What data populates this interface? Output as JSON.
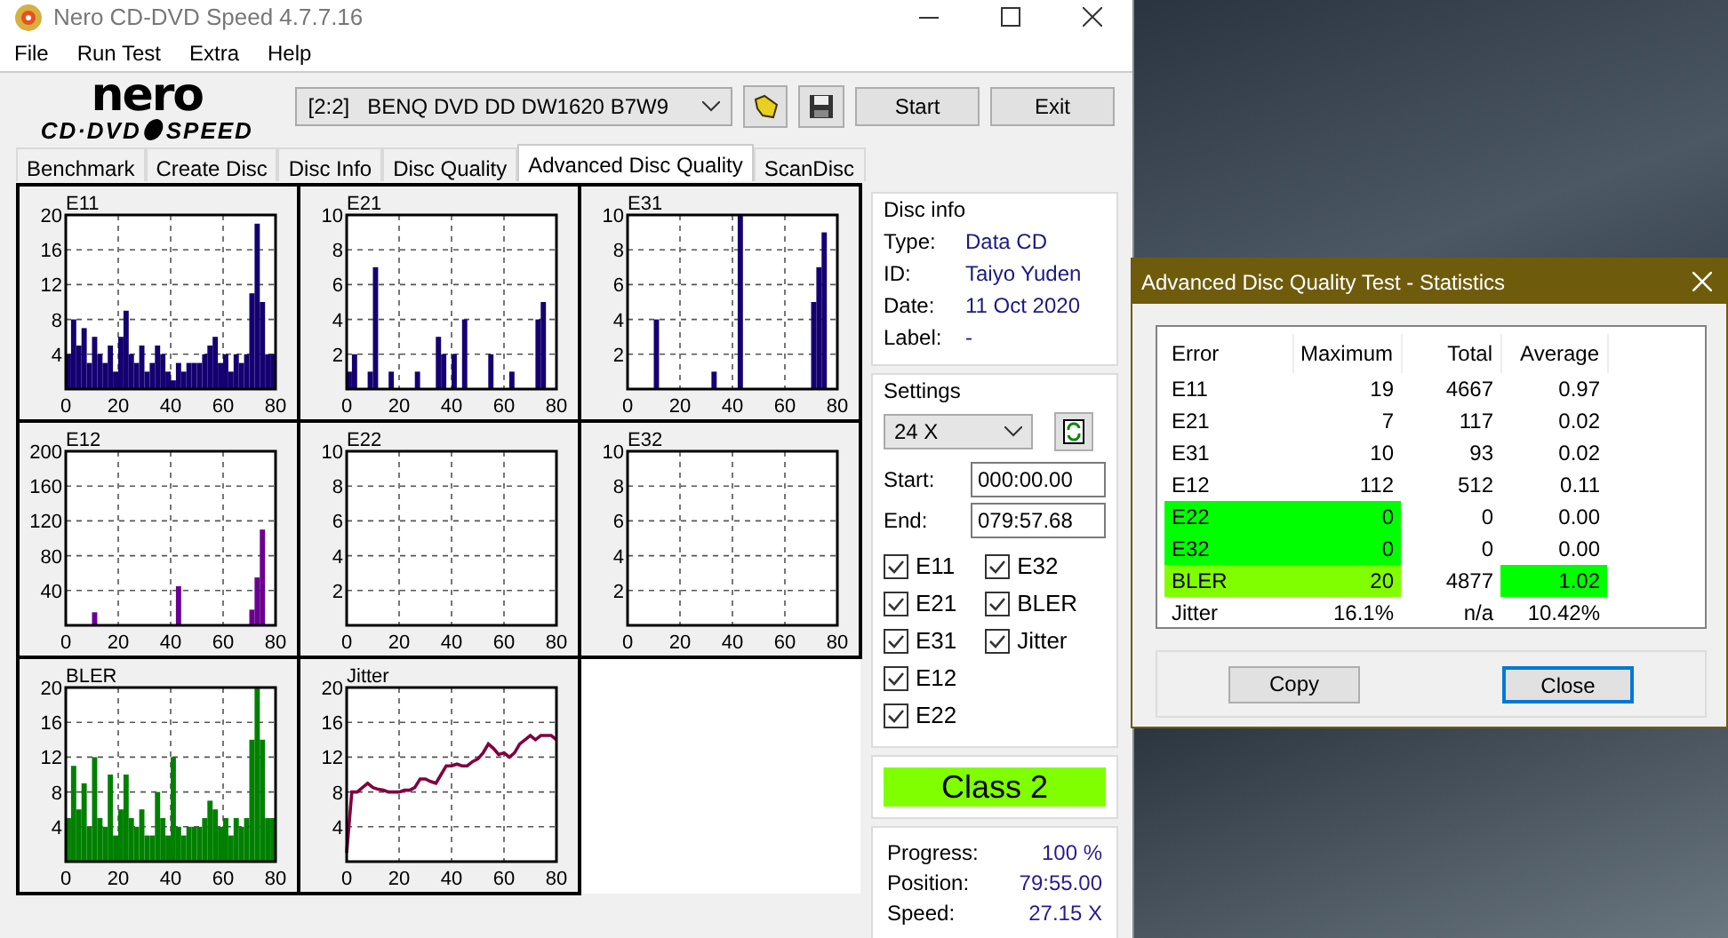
{
  "window": {
    "title": "Nero CD-DVD Speed 4.7.7.16"
  },
  "menu": [
    "File",
    "Run Test",
    "Extra",
    "Help"
  ],
  "logo": {
    "top": "nero",
    "left": "CD·DVD",
    "right": "SPEED"
  },
  "toolbar": {
    "drive": "[2:2]   BENQ DVD DD DW1620 B7W9",
    "buttons": [
      "Start",
      "Exit"
    ]
  },
  "tabs": [
    {
      "label": "Benchmark",
      "selected": false
    },
    {
      "label": "Create Disc",
      "selected": false
    },
    {
      "label": "Disc Info",
      "selected": false
    },
    {
      "label": "Disc Quality",
      "selected": false
    },
    {
      "label": "Advanced Disc Quality",
      "selected": true
    },
    {
      "label": "ScanDisc",
      "selected": false
    }
  ],
  "charts": [
    {
      "chart_data": {
        "type": "bar",
        "title": "E11",
        "grid": true,
        "x": [
          0,
          2,
          4,
          6,
          8,
          10,
          12,
          14,
          16,
          18,
          20,
          22,
          24,
          26,
          28,
          30,
          32,
          34,
          36,
          38,
          40,
          42,
          44,
          46,
          48,
          50,
          52,
          54,
          56,
          58,
          60,
          62,
          64,
          66,
          68,
          70,
          72,
          74,
          76,
          78
        ],
        "xlim": [
          0,
          80
        ],
        "ylim": [
          0,
          20
        ],
        "xticks": [
          0,
          20,
          40,
          60,
          80
        ],
        "yticks": [
          4,
          8,
          12,
          16,
          20
        ],
        "series": [
          {
            "color": "#140070",
            "values": [
              4,
              8,
              5,
              7,
              3,
              6,
              4,
              3,
              5,
              2,
              6,
              9,
              4,
              3,
              5,
              2,
              3,
              5,
              4,
              2,
              1,
              3,
              2,
              3,
              3,
              3,
              4,
              5,
              6,
              3,
              4,
              2,
              4,
              3,
              4,
              11,
              19,
              10,
              4,
              4
            ]
          }
        ]
      }
    },
    {
      "chart_data": {
        "type": "bar",
        "title": "E21",
        "grid": true,
        "x": [
          0,
          2,
          4,
          6,
          8,
          10,
          12,
          14,
          16,
          18,
          20,
          22,
          24,
          26,
          28,
          30,
          32,
          34,
          36,
          38,
          40,
          42,
          44,
          46,
          48,
          50,
          52,
          54,
          56,
          58,
          60,
          62,
          64,
          66,
          68,
          70,
          72,
          74,
          76,
          78
        ],
        "xlim": [
          0,
          80
        ],
        "ylim": [
          0,
          10
        ],
        "xticks": [
          0,
          20,
          40,
          60,
          80
        ],
        "yticks": [
          2,
          4,
          6,
          8,
          10
        ],
        "series": [
          {
            "color": "#140070",
            "values": [
              1,
              2,
              0,
              0,
              1,
              7,
              0,
              0,
              1,
              0,
              0,
              0,
              0,
              1,
              0,
              0,
              0,
              3,
              2,
              0,
              2,
              0,
              4,
              0,
              0,
              0,
              0,
              2,
              0,
              0,
              0,
              1,
              0,
              0,
              0,
              0,
              4,
              5,
              0,
              0
            ]
          }
        ]
      }
    },
    {
      "chart_data": {
        "type": "bar",
        "title": "E31",
        "grid": true,
        "x": [
          0,
          2,
          4,
          6,
          8,
          10,
          12,
          14,
          16,
          18,
          20,
          22,
          24,
          26,
          28,
          30,
          32,
          34,
          36,
          38,
          40,
          42,
          44,
          46,
          48,
          50,
          52,
          54,
          56,
          58,
          60,
          62,
          64,
          66,
          68,
          70,
          72,
          74,
          76,
          78
        ],
        "xlim": [
          0,
          80
        ],
        "ylim": [
          0,
          10
        ],
        "xticks": [
          0,
          20,
          40,
          60,
          80
        ],
        "yticks": [
          2,
          4,
          6,
          8,
          10
        ],
        "series": [
          {
            "color": "#140070",
            "values": [
              0,
              0,
              0,
              0,
              0,
              4,
              0,
              0,
              0,
              0,
              0,
              0,
              0,
              0,
              0,
              0,
              1,
              0,
              0,
              0,
              0,
              10,
              0,
              0,
              0,
              0,
              0,
              0,
              0,
              0,
              0,
              0,
              0,
              0,
              0,
              5,
              7,
              9,
              0,
              0
            ]
          }
        ]
      }
    },
    {
      "chart_data": {
        "type": "bar",
        "title": "E12",
        "grid": true,
        "x": [
          0,
          2,
          4,
          6,
          8,
          10,
          12,
          14,
          16,
          18,
          20,
          22,
          24,
          26,
          28,
          30,
          32,
          34,
          36,
          38,
          40,
          42,
          44,
          46,
          48,
          50,
          52,
          54,
          56,
          58,
          60,
          62,
          64,
          66,
          68,
          70,
          72,
          74,
          76,
          78
        ],
        "xlim": [
          0,
          80
        ],
        "ylim": [
          0,
          200
        ],
        "xticks": [
          0,
          20,
          40,
          60,
          80
        ],
        "yticks": [
          40,
          80,
          120,
          160,
          200
        ],
        "series": [
          {
            "color": "#6a0090",
            "values": [
              0,
              0,
              0,
              0,
              0,
              15,
              0,
              0,
              0,
              0,
              0,
              0,
              0,
              0,
              0,
              0,
              0,
              0,
              0,
              0,
              0,
              45,
              0,
              0,
              0,
              0,
              0,
              0,
              0,
              0,
              0,
              0,
              0,
              0,
              0,
              18,
              55,
              110,
              0,
              0
            ]
          }
        ]
      }
    },
    {
      "chart_data": {
        "type": "bar",
        "title": "E22",
        "grid": true,
        "x": [
          0,
          2,
          4,
          6,
          8,
          10,
          12,
          14,
          16,
          18,
          20,
          22,
          24,
          26,
          28,
          30,
          32,
          34,
          36,
          38,
          40,
          42,
          44,
          46,
          48,
          50,
          52,
          54,
          56,
          58,
          60,
          62,
          64,
          66,
          68,
          70,
          72,
          74,
          76,
          78
        ],
        "xlim": [
          0,
          80
        ],
        "ylim": [
          0,
          10
        ],
        "xticks": [
          0,
          20,
          40,
          60,
          80
        ],
        "yticks": [
          2,
          4,
          6,
          8,
          10
        ],
        "series": [
          {
            "values": [
              0,
              0,
              0,
              0,
              0,
              0,
              0,
              0,
              0,
              0,
              0,
              0,
              0,
              0,
              0,
              0,
              0,
              0,
              0,
              0,
              0,
              0,
              0,
              0,
              0,
              0,
              0,
              0,
              0,
              0,
              0,
              0,
              0,
              0,
              0,
              0,
              0,
              0,
              0,
              0
            ]
          }
        ]
      }
    },
    {
      "chart_data": {
        "type": "bar",
        "title": "E32",
        "grid": true,
        "x": [
          0,
          2,
          4,
          6,
          8,
          10,
          12,
          14,
          16,
          18,
          20,
          22,
          24,
          26,
          28,
          30,
          32,
          34,
          36,
          38,
          40,
          42,
          44,
          46,
          48,
          50,
          52,
          54,
          56,
          58,
          60,
          62,
          64,
          66,
          68,
          70,
          72,
          74,
          76,
          78
        ],
        "xlim": [
          0,
          80
        ],
        "ylim": [
          0,
          10
        ],
        "xticks": [
          0,
          20,
          40,
          60,
          80
        ],
        "yticks": [
          2,
          4,
          6,
          8,
          10
        ],
        "series": [
          {
            "values": [
              0,
              0,
              0,
              0,
              0,
              0,
              0,
              0,
              0,
              0,
              0,
              0,
              0,
              0,
              0,
              0,
              0,
              0,
              0,
              0,
              0,
              0,
              0,
              0,
              0,
              0,
              0,
              0,
              0,
              0,
              0,
              0,
              0,
              0,
              0,
              0,
              0,
              0,
              0,
              0
            ]
          }
        ]
      }
    },
    {
      "chart_data": {
        "type": "bar",
        "title": "BLER",
        "grid": true,
        "x": [
          0,
          2,
          4,
          6,
          8,
          10,
          12,
          14,
          16,
          18,
          20,
          22,
          24,
          26,
          28,
          30,
          32,
          34,
          36,
          38,
          40,
          42,
          44,
          46,
          48,
          50,
          52,
          54,
          56,
          58,
          60,
          62,
          64,
          66,
          68,
          70,
          72,
          74,
          76,
          78
        ],
        "xlim": [
          0,
          80
        ],
        "ylim": [
          0,
          20
        ],
        "xticks": [
          0,
          20,
          40,
          60,
          80
        ],
        "yticks": [
          4,
          8,
          12,
          16,
          20
        ],
        "series": [
          {
            "color": "#008000",
            "values": [
              5,
              11,
              6,
              9,
              4,
              12,
              5,
              4,
              10,
              3,
              6,
              10,
              5,
              4,
              6,
              3,
              3,
              8,
              5,
              3,
              12,
              4,
              3,
              4,
              4,
              4,
              5,
              7,
              6,
              4,
              5,
              3,
              5,
              4,
              5,
              14,
              20,
              14,
              5,
              5
            ]
          }
        ]
      }
    },
    {
      "chart_data": {
        "type": "line",
        "title": "Jitter",
        "grid": true,
        "x": [
          0,
          2,
          4,
          6,
          8,
          10,
          12,
          14,
          16,
          18,
          20,
          22,
          24,
          26,
          28,
          30,
          32,
          34,
          36,
          38,
          40,
          42,
          44,
          46,
          48,
          50,
          52,
          54,
          56,
          58,
          60,
          62,
          64,
          66,
          68,
          70,
          72,
          74,
          76,
          78,
          80
        ],
        "xlim": [
          0,
          80
        ],
        "ylim": [
          0,
          20
        ],
        "xticks": [
          0,
          20,
          40,
          60,
          80
        ],
        "yticks": [
          4,
          8,
          12,
          16,
          20
        ],
        "series": [
          {
            "color": "#800040",
            "values": [
              1,
              8,
              8,
              8.5,
              9,
              8.5,
              8.3,
              8.2,
              8,
              8,
              8,
              8.2,
              8.2,
              8.5,
              9.5,
              9.5,
              9.2,
              9,
              10,
              11,
              11,
              11.2,
              11,
              11,
              11.5,
              11.8,
              12.5,
              13.5,
              13,
              12.3,
              12.5,
              12,
              12.5,
              13.5,
              14,
              14.5,
              14,
              14.5,
              14.5,
              14.5,
              14
            ]
          }
        ]
      }
    }
  ],
  "disc_info": {
    "title": "Disc info",
    "rows": [
      {
        "label": "Type:",
        "value": "Data CD"
      },
      {
        "label": "ID:",
        "value": "Taiyo Yuden"
      },
      {
        "label": "Date:",
        "value": "11 Oct 2020"
      },
      {
        "label": "Label:",
        "value": "-"
      }
    ]
  },
  "settings": {
    "title": "Settings",
    "speed": "24 X",
    "start_label": "Start:",
    "start": "000:00.00",
    "end_label": "End:",
    "end": "079:57.68",
    "checkboxes": [
      {
        "label": "E11",
        "checked": true
      },
      {
        "label": "E21",
        "checked": true
      },
      {
        "label": "E31",
        "checked": true
      },
      {
        "label": "E12",
        "checked": true
      },
      {
        "label": "E22",
        "checked": true
      },
      {
        "label": "E32",
        "checked": true
      },
      {
        "label": "BLER",
        "checked": true
      },
      {
        "label": "Jitter",
        "checked": true
      }
    ]
  },
  "class_result": {
    "label": "Class 2",
    "color": "#80ff00"
  },
  "progress": [
    {
      "label": "Progress:",
      "value": "100 %"
    },
    {
      "label": "Position:",
      "value": "79:55.00"
    },
    {
      "label": "Speed:",
      "value": "27.15 X"
    }
  ],
  "dialog": {
    "title": "Advanced Disc Quality Test - Statistics",
    "columns": [
      "Error",
      "Maximum",
      "Total",
      "Average"
    ],
    "rows": [
      {
        "cells": [
          {
            "text": "E11"
          },
          {
            "text": "19"
          },
          {
            "text": "4667"
          },
          {
            "text": "0.97"
          }
        ]
      },
      {
        "cells": [
          {
            "text": "E21"
          },
          {
            "text": "7"
          },
          {
            "text": "117"
          },
          {
            "text": "0.02"
          }
        ]
      },
      {
        "cells": [
          {
            "text": "E31"
          },
          {
            "text": "10"
          },
          {
            "text": "93"
          },
          {
            "text": "0.02"
          }
        ]
      },
      {
        "cells": [
          {
            "text": "E12"
          },
          {
            "text": "112"
          },
          {
            "text": "512"
          },
          {
            "text": "0.11"
          }
        ]
      },
      {
        "cells": [
          {
            "text": "E22",
            "color": "#00ff00"
          },
          {
            "text": "0",
            "color": "#00ff00"
          },
          {
            "text": "0"
          },
          {
            "text": "0.00"
          }
        ]
      },
      {
        "cells": [
          {
            "text": "E32",
            "color": "#00ff00"
          },
          {
            "text": "0",
            "color": "#00ff00"
          },
          {
            "text": "0"
          },
          {
            "text": "0.00"
          }
        ]
      },
      {
        "cells": [
          {
            "text": "BLER",
            "color": "#80ff00"
          },
          {
            "text": "20",
            "color": "#80ff00"
          },
          {
            "text": "4877"
          },
          {
            "text": "1.02",
            "color": "#00ff00"
          }
        ]
      },
      {
        "cells": [
          {
            "text": "Jitter"
          },
          {
            "text": "16.1%"
          },
          {
            "text": "n/a"
          },
          {
            "text": "10.42%"
          }
        ]
      }
    ],
    "buttons": [
      {
        "label": "Copy",
        "focused": false
      },
      {
        "label": "Close",
        "focused": true
      }
    ]
  }
}
